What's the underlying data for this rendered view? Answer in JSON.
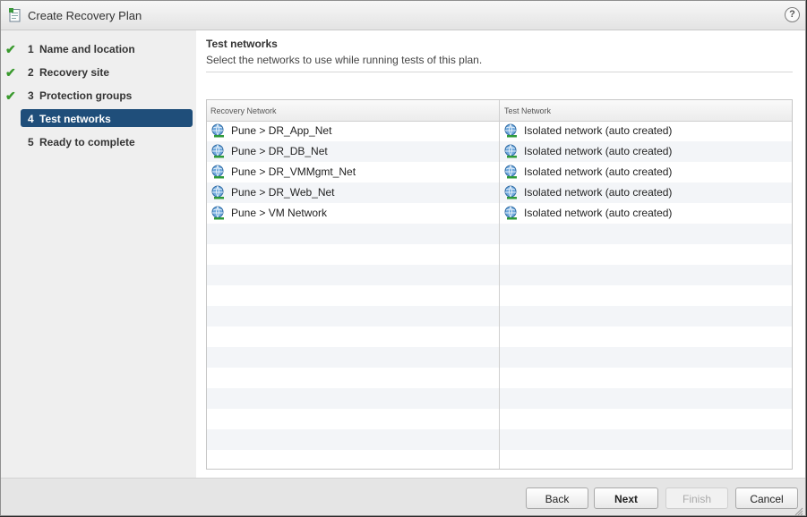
{
  "window": {
    "title": "Create Recovery Plan",
    "help_label": "?"
  },
  "steps": [
    {
      "num": "1",
      "label": "Name and location",
      "done": true
    },
    {
      "num": "2",
      "label": "Recovery site",
      "done": true
    },
    {
      "num": "3",
      "label": "Protection groups",
      "done": true
    },
    {
      "num": "4",
      "label": "Test networks",
      "active": true
    },
    {
      "num": "5",
      "label": "Ready to complete"
    }
  ],
  "page": {
    "heading": "Test networks",
    "subheading": "Select the networks to use while running tests of this plan."
  },
  "table": {
    "columns": [
      "Recovery Network",
      "Test Network"
    ],
    "rows": [
      {
        "recovery": "Pune > DR_App_Net",
        "test": "Isolated network (auto created)"
      },
      {
        "recovery": "Pune > DR_DB_Net",
        "test": "Isolated network (auto created)"
      },
      {
        "recovery": "Pune > DR_VMMgmt_Net",
        "test": "Isolated network (auto created)"
      },
      {
        "recovery": "Pune > DR_Web_Net",
        "test": "Isolated network (auto created)"
      },
      {
        "recovery": "Pune > VM Network",
        "test": "Isolated network (auto created)"
      }
    ]
  },
  "buttons": {
    "back": "Back",
    "next": "Next",
    "finish": "Finish",
    "cancel": "Cancel"
  },
  "icons": {
    "check": "check-icon",
    "network": "network-icon",
    "wizard": "wizard-icon",
    "help": "help-icon"
  },
  "colors": {
    "active_step": "#1f4e7a",
    "check": "#3a9a2e"
  }
}
